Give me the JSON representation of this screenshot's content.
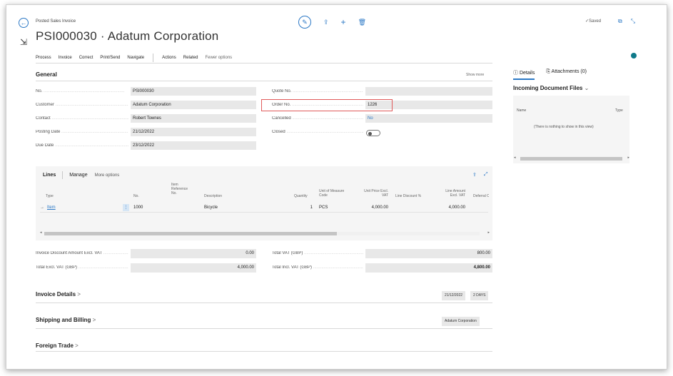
{
  "header": {
    "back_icon": "back-arrow-icon",
    "caption": "Posted Sales Invoice",
    "title": "PSI000030 · Adatum Corporation",
    "saved": "✓Saved"
  },
  "actions": [
    "Process",
    "Invoice",
    "Correct",
    "Print/Send",
    "Navigate",
    "Actions",
    "Related",
    "Fewer options"
  ],
  "general": {
    "title": "General",
    "show_more": "Show more",
    "fields_left": [
      {
        "label": "No.",
        "value": "PSI000030"
      },
      {
        "label": "Customer",
        "value": "Adatum Corporation"
      },
      {
        "label": "Contact",
        "value": "Robert Townes"
      },
      {
        "label": "Posting Date",
        "value": "21/12/2022"
      },
      {
        "label": "Due Date",
        "value": "23/12/2022"
      }
    ],
    "fields_right": [
      {
        "label": "Quote No.",
        "value": ""
      },
      {
        "label": "Order No.",
        "value": "1226"
      },
      {
        "label": "Cancelled",
        "value": "No"
      },
      {
        "label": "Closed",
        "value": ""
      }
    ]
  },
  "lines": {
    "tab_lines": "Lines",
    "tab_manage": "Manage",
    "tab_more": "More options",
    "columns": {
      "type": "Type",
      "no": "No.",
      "item_ref": "Item Reference No.",
      "description": "Description",
      "quantity": "Quantity",
      "uom": "Unit of Measure Code",
      "unit_price": "Unit Price Excl. VAT",
      "line_discount": "Line Discount %",
      "line_amount": "Line Amount Excl. VAT",
      "deferral": "Deferral C"
    },
    "row": {
      "arrow": "→",
      "type": "Item",
      "no": "1000",
      "description": "Bicycle",
      "quantity": "1",
      "uom": "PCS",
      "unit_price": "4,000.00",
      "line_amount": "4,000.00"
    }
  },
  "totals": {
    "inv_discount_label": "Invoice Discount Amount Excl. VAT",
    "inv_discount_value": "0.00",
    "total_excl_label": "Total Excl. VAT (GBP)",
    "total_excl_value": "4,000.00",
    "total_vat_label": "Total VAT (GBP)",
    "total_vat_value": "800.00",
    "total_incl_label": "Total Incl. VAT (GBP)",
    "total_incl_value": "4,800.00"
  },
  "fasttabs": {
    "invoice_details": "Invoice Details",
    "invoice_details_date": "21/12/2022",
    "invoice_details_days": "2 DAYS",
    "shipping": "Shipping and Billing",
    "shipping_summary": "Adatum Corporation",
    "foreign": "Foreign Trade",
    "chevron": ">"
  },
  "factbox": {
    "tab_details": "Details",
    "tab_attachments": "Attachments (0)",
    "title": "Incoming Document Files",
    "col_name": "Name",
    "col_type": "Type",
    "empty": "(There is nothing to show in this view)"
  },
  "colors": {
    "accent": "#2b78c5",
    "highlight": "#e05a5a",
    "info": "#0f7a8a"
  }
}
